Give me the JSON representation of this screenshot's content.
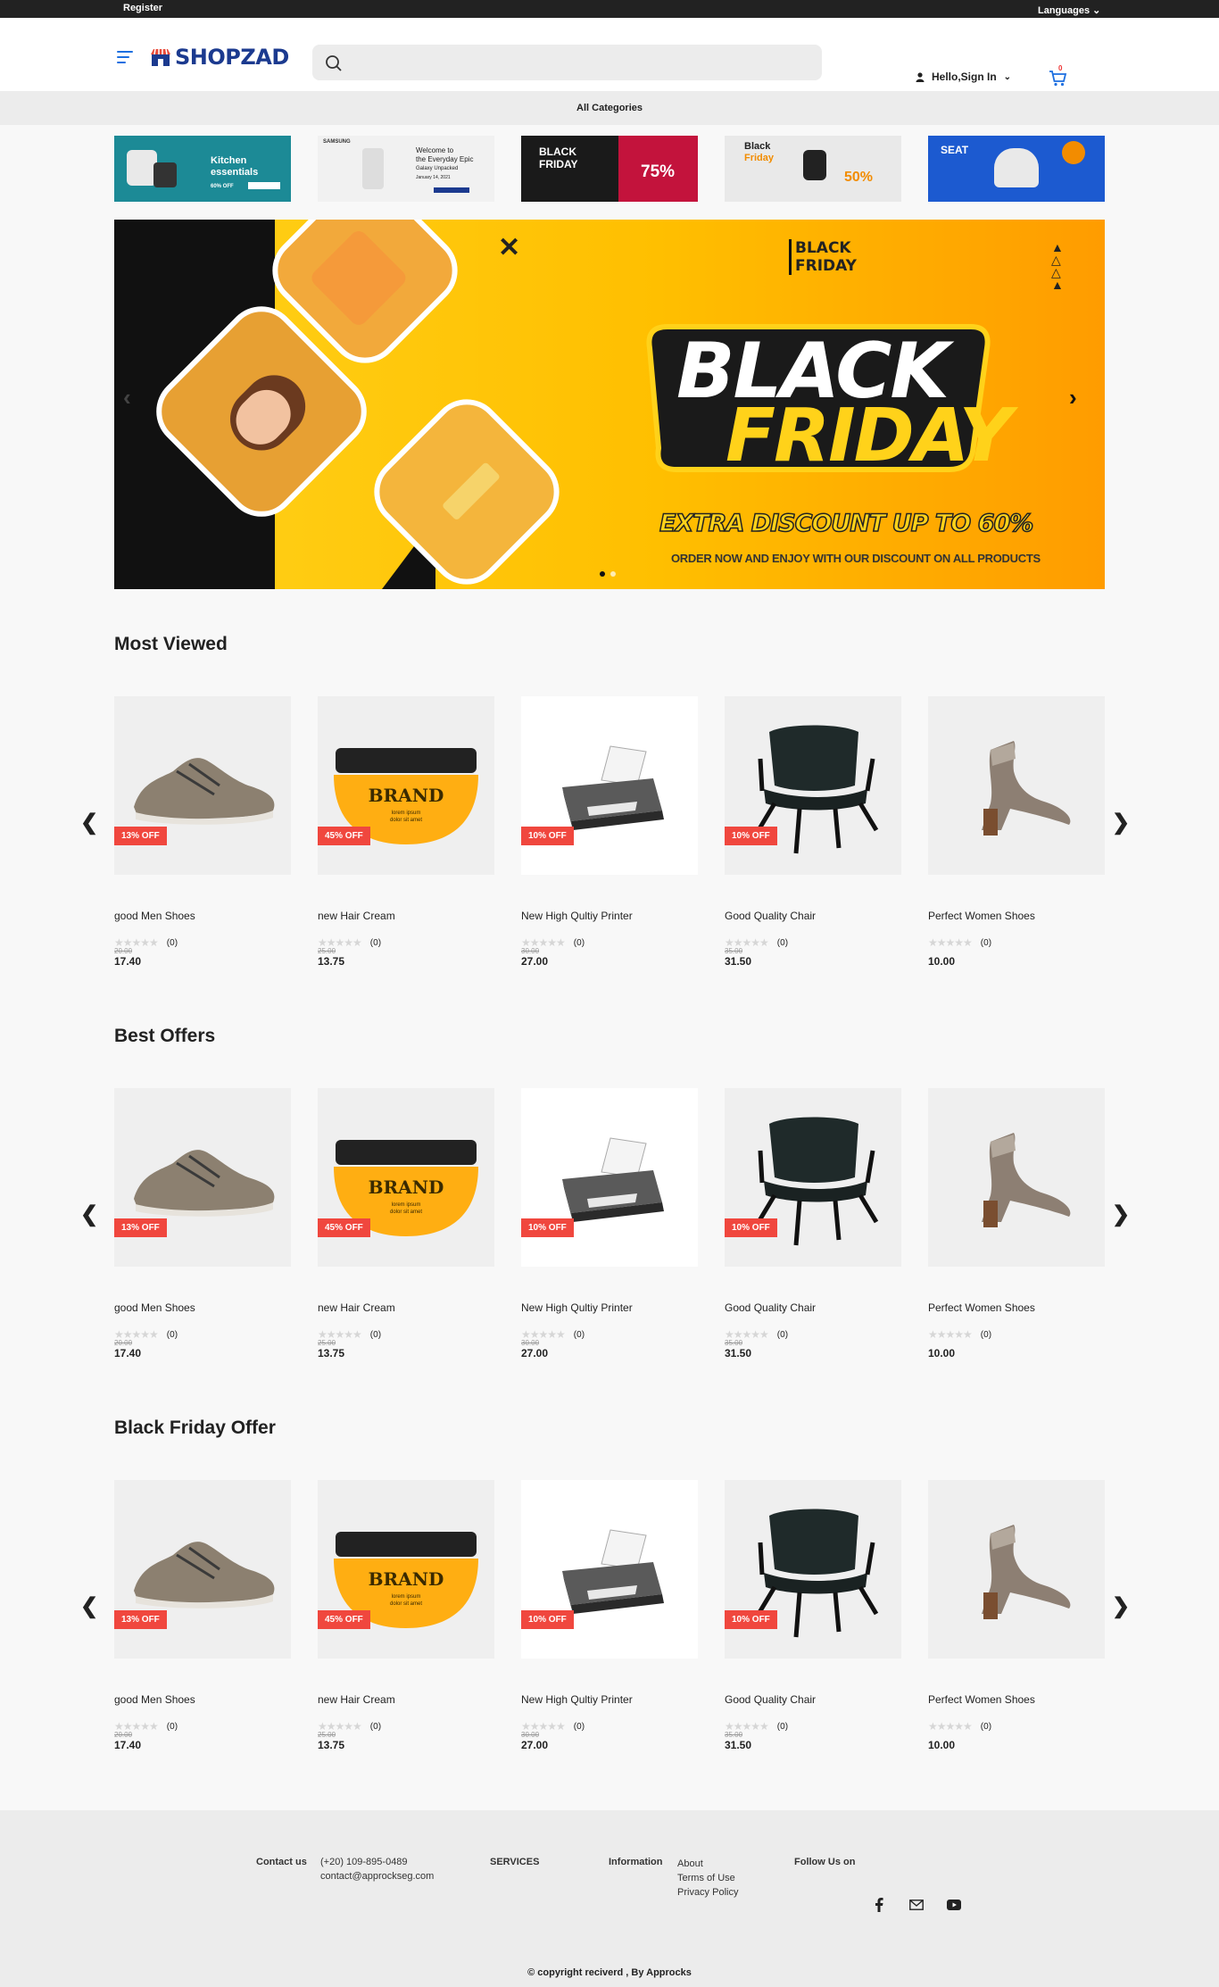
{
  "topbar": {
    "register": "Register",
    "languages": "Languages"
  },
  "header": {
    "logo": "SHOPZAD",
    "search_placeholder": "",
    "signin": "Hello,Sign In",
    "cart_count": "0"
  },
  "category_bar": "All Categories",
  "promos": [
    {
      "text1": "Kitchen",
      "text2": "essentials",
      "tag": "60% OFF"
    },
    {
      "brand": "SAMSUNG",
      "text1": "Welcome to",
      "text2": "the Everyday Epic",
      "text3": "Galaxy Unpacked",
      "text4": "January 14, 2021"
    },
    {
      "text1": "BLACK",
      "text2": "FRIDAY",
      "tag": "75%"
    },
    {
      "text1": "Black",
      "text2": "Friday",
      "tag": "50%"
    },
    {
      "text1": "SEAT"
    }
  ],
  "hero": {
    "small_title_1": "BLACK",
    "small_title_2": "FRIDAY",
    "title_1": "BLACK",
    "title_2": "FRIDAY",
    "extra": "EXTRA DISCOUNT UP TO 60%",
    "order": "ORDER NOW AND ENJOY WITH OUR DISCOUNT ON ALL PRODUCTS"
  },
  "sections": [
    {
      "title": "Most Viewed"
    },
    {
      "title": "Best Offers"
    },
    {
      "title": "Black Friday Offer"
    }
  ],
  "products": [
    {
      "name": "good Men Shoes",
      "badge": "13% OFF",
      "reviews": "(0)",
      "old_price": "20.00",
      "price": "17.40"
    },
    {
      "name": "new Hair Cream",
      "badge": "45% OFF",
      "reviews": "(0)",
      "old_price": "25.00",
      "price": "13.75"
    },
    {
      "name": "New High Qultiy Printer",
      "badge": "10% OFF",
      "reviews": "(0)",
      "old_price": "30.00",
      "price": "27.00"
    },
    {
      "name": "Good Quality Chair",
      "badge": "10% OFF",
      "reviews": "(0)",
      "old_price": "35.00",
      "price": "31.50"
    },
    {
      "name": "Perfect Women Shoes",
      "badge": "",
      "reviews": "(0)",
      "old_price": "",
      "price": "10.00"
    }
  ],
  "footer": {
    "contact_head": "Contact us",
    "phone": "(+20) 109-895-0489",
    "email": "contact@approckseg.com",
    "services_head": "SERVICES",
    "info_head": "Information",
    "about": "About",
    "terms": "Terms of Use",
    "privacy": "Privacy Policy",
    "follow_head": "Follow Us on",
    "copyright": "© copyright reciverd , By Approcks"
  },
  "colors": {
    "accent": "#1d6fe0",
    "badge": "#f0473e",
    "hero_yellow": "#ffc800",
    "dark": "#222222"
  }
}
